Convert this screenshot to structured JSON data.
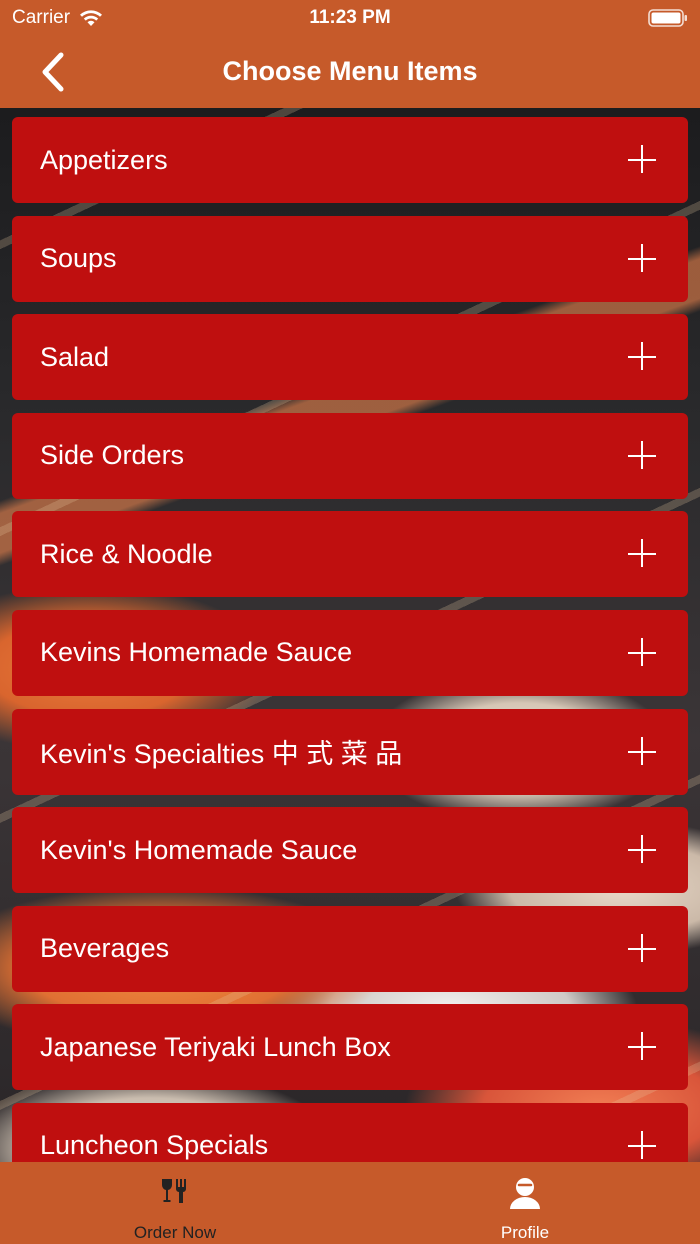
{
  "status_bar": {
    "carrier": "Carrier",
    "time": "11:23 PM"
  },
  "nav": {
    "title": "Choose Menu Items",
    "back_icon": "chevron-left-icon"
  },
  "colors": {
    "header": "#c65a2a",
    "item_background": "#bf0f0f",
    "text": "#ffffff"
  },
  "menu": {
    "items": [
      {
        "label": "Appetizers"
      },
      {
        "label": "Soups"
      },
      {
        "label": "Salad"
      },
      {
        "label": "Side Orders"
      },
      {
        "label": "Rice & Noodle"
      },
      {
        "label": "Kevins Homemade Sauce"
      },
      {
        "label": "Kevin's Specialties 中 式 菜 品"
      },
      {
        "label": "Kevin's Homemade Sauce"
      },
      {
        "label": "Beverages"
      },
      {
        "label": "Japanese Teriyaki Lunch Box"
      },
      {
        "label": "Luncheon Specials"
      }
    ],
    "expand_icon": "plus-icon"
  },
  "tabbar": {
    "tabs": [
      {
        "label": "Order Now",
        "icon": "dining-icon"
      },
      {
        "label": "Profile",
        "icon": "person-icon"
      }
    ]
  }
}
